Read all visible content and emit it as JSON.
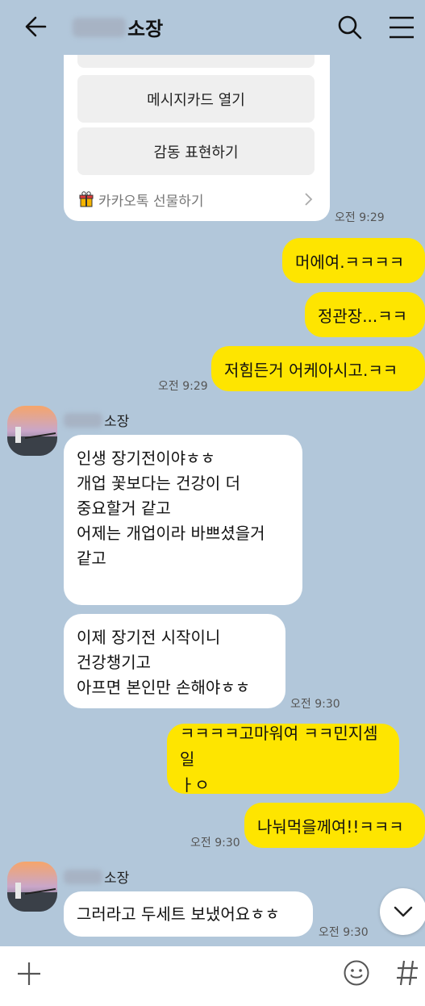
{
  "header": {
    "name_suffix": "소장"
  },
  "card": {
    "button1": "메시지카드 열기",
    "button2": "감동 표현하기",
    "footer": "카카오톡 선물하기",
    "time": "오전 9:29"
  },
  "messages": {
    "me1": "머에여.ㅋㅋㅋㅋ",
    "me2": "정관장...ㅋㅋ",
    "me3": "저힘든거 어케아시고.ㅋㅋ",
    "me3_time": "오전 9:29",
    "sender": "소장",
    "other1": [
      "인생 장기전이야ㅎㅎ",
      "개업 꽃보다는 건강이 더",
      "중요할거 같고",
      "어제는 개업이라 바쁘셨을거",
      "같고"
    ],
    "other2": [
      "이제 장기전 시작이니",
      "건강챙기고",
      "아프면  본인만 손해야ㅎㅎ"
    ],
    "other2_time": "오전 9:30",
    "me4": [
      "ㅋㅋㅋㅋ고마워여 ㅋㅋ민지셈일",
      "ㅏㅇ"
    ],
    "me5": "나눠먹을께여!!ㅋㅋㅋ",
    "me5_time": "오전 9:30",
    "other3": "그러라고 두세트 보냈어요ㅎㅎ",
    "other3_time": "오전 9:30"
  },
  "icons": {
    "back": "back-arrow-icon",
    "search": "search-icon",
    "menu": "menu-icon",
    "gift": "gift-icon",
    "scroll": "chevron-down-icon",
    "attach": "plus-icon",
    "emoticon": "emoji-icon",
    "hash": "hash-icon"
  }
}
